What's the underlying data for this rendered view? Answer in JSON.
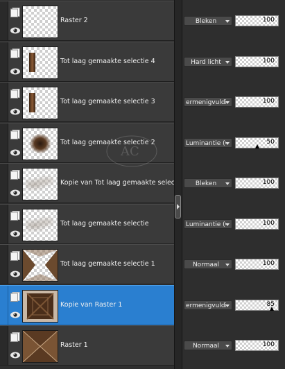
{
  "layers": [
    {
      "name": "Raster 2",
      "blend": "Bleken",
      "opacity": "100",
      "opacity_fraction": 1.0,
      "selected": false,
      "thumb": "empty"
    },
    {
      "name": "Tot laag gemaakte selectie 4",
      "blend": "Hard licht",
      "opacity": "100",
      "opacity_fraction": 1.0,
      "selected": false,
      "thumb": "small-strip"
    },
    {
      "name": "Tot laag gemaakte selectie 3",
      "blend": "ermenigvuldige",
      "opacity": "100",
      "opacity_fraction": 1.0,
      "selected": false,
      "thumb": "small-strip"
    },
    {
      "name": "Tot laag gemaakte selectie 2",
      "blend": "Luminantie (O)",
      "opacity": "50",
      "opacity_fraction": 0.5,
      "selected": false,
      "thumb": "dark-blob"
    },
    {
      "name": "Kopie van Tot laag gemaakte selectie",
      "blend": "Bleken",
      "opacity": "100",
      "opacity_fraction": 1.0,
      "selected": false,
      "thumb": "light-scatter"
    },
    {
      "name": "Tot laag gemaakte selectie",
      "blend": "Luminantie (O)",
      "opacity": "100",
      "opacity_fraction": 1.0,
      "selected": false,
      "thumb": "light-scatter"
    },
    {
      "name": "Tot laag gemaakte selectie 1",
      "blend": "Normaal",
      "opacity": "100",
      "opacity_fraction": 1.0,
      "selected": false,
      "thumb": "corner-wedges"
    },
    {
      "name": "Kopie van Raster 1",
      "blend": "ermenigvuldige",
      "opacity": "85",
      "opacity_fraction": 0.85,
      "selected": true,
      "thumb": "brown-frame"
    },
    {
      "name": "Raster 1",
      "blend": "Normaal",
      "opacity": "100",
      "opacity_fraction": 1.0,
      "selected": false,
      "thumb": "brown-x"
    }
  ],
  "watermark_text": "AC",
  "colors": {
    "selected_row": "#2a7fd0",
    "row_bg": "#3a3a3a",
    "thumb_brown": "#5a3a22"
  }
}
